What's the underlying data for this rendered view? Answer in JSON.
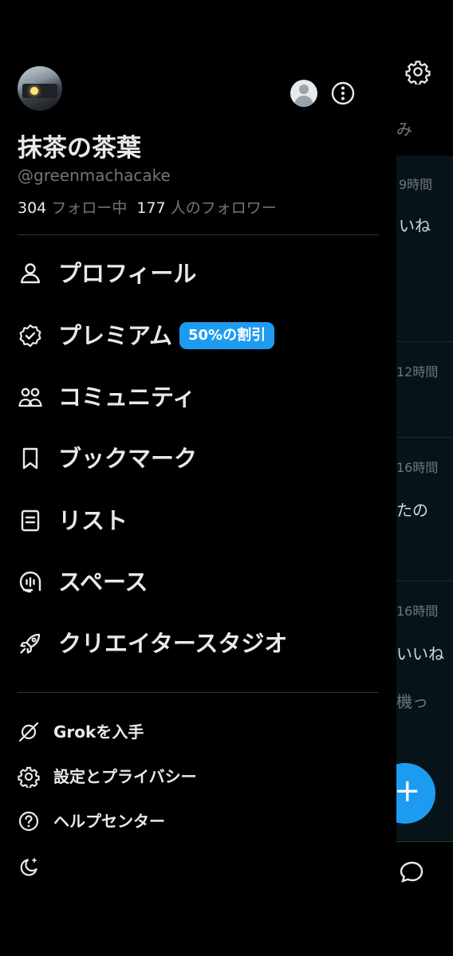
{
  "background": {
    "timeline_snippets": [
      {
        "time": "9時間",
        "text": "いね"
      },
      {
        "time": "12時間",
        "text": ""
      },
      {
        "time": "16時間",
        "text": "たの"
      },
      {
        "time": "16時間",
        "text": "いいね",
        "text2": "機っ"
      }
    ],
    "tab_fragment": "み",
    "fab_symbol": "+"
  },
  "profile": {
    "display_name": "抹茶の茶葉",
    "handle": "@greenmachacake",
    "following_count": "304",
    "following_label": "フォロー中",
    "followers_count": "177",
    "followers_label": "人のフォロワー"
  },
  "menu": {
    "items": [
      {
        "label": "プロフィール",
        "icon": "person-icon"
      },
      {
        "label": "プレミアム",
        "icon": "verified-badge-icon",
        "badge": "50%の割引"
      },
      {
        "label": "コミュニティ",
        "icon": "communities-icon"
      },
      {
        "label": "ブックマーク",
        "icon": "bookmark-icon"
      },
      {
        "label": "リスト",
        "icon": "lists-icon"
      },
      {
        "label": "スペース",
        "icon": "spaces-icon"
      },
      {
        "label": "クリエイタースタジオ",
        "icon": "rocket-icon"
      }
    ],
    "secondary": [
      {
        "label": "Grokを入手",
        "icon": "grok-icon"
      },
      {
        "label": "設定とプライバシー",
        "icon": "gear-icon"
      },
      {
        "label": "ヘルプセンター",
        "icon": "help-icon"
      }
    ]
  },
  "colors": {
    "accent": "#1d9bf0",
    "text_primary": "#e7e9ea",
    "text_secondary": "#71767b",
    "background": "#000000"
  }
}
